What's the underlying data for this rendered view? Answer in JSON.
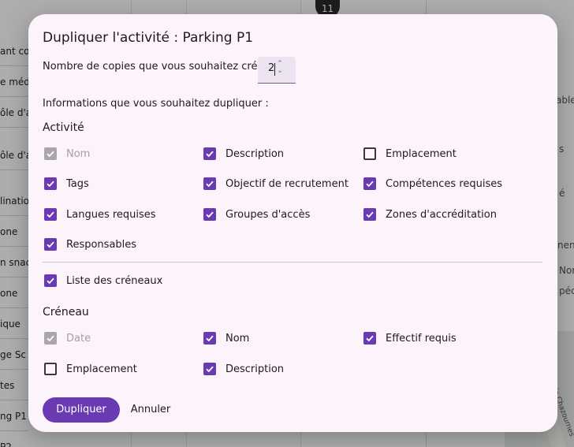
{
  "background": {
    "badge": "11",
    "left_items": [
      "ant co",
      "e méd",
      "ôle d'a",
      "ôle d'a",
      "lination",
      "one",
      "n snac",
      "one",
      "ique",
      "ge Sc",
      "tes",
      "ng P1",
      "P2"
    ],
    "right_texts": [
      "able",
      "s",
      "é",
      "nen",
      "Nor",
      "péc"
    ],
    "map_label": "Rue de Chazournes"
  },
  "dialog": {
    "title": "Dupliquer l'activité : Parking P1",
    "copies_label": "Nombre de copies que vous souhaitez créer :",
    "copies_value": "2",
    "info_label": "Informations que vous souhaitez dupliquer :",
    "activity_section": "Activité",
    "activity_options": [
      {
        "label": "Nom",
        "state": "disabled"
      },
      {
        "label": "Description",
        "state": "checked"
      },
      {
        "label": "Emplacement",
        "state": "empty"
      },
      {
        "label": "Tags",
        "state": "checked"
      },
      {
        "label": "Objectif de recrutement",
        "state": "checked"
      },
      {
        "label": "Compétences requises",
        "state": "checked"
      },
      {
        "label": "Langues requises",
        "state": "checked"
      },
      {
        "label": "Groupes d'accès",
        "state": "checked"
      },
      {
        "label": "Zones d'accréditation",
        "state": "checked"
      },
      {
        "label": "Responsables",
        "state": "checked"
      }
    ],
    "slots_list_option": {
      "label": "Liste des créneaux",
      "state": "checked"
    },
    "slot_section": "Créneau",
    "slot_options": [
      {
        "label": "Date",
        "state": "disabled"
      },
      {
        "label": "Nom",
        "state": "checked"
      },
      {
        "label": "Effectif requis",
        "state": "checked"
      },
      {
        "label": "Emplacement",
        "state": "empty"
      },
      {
        "label": "Description",
        "state": "checked"
      }
    ],
    "duplicate_button": "Dupliquer",
    "cancel_button": "Annuler"
  },
  "colors": {
    "accent": "#6a3ab2",
    "dialog_bg": "#fdf3fb",
    "disabled": "#a9a7ad"
  }
}
